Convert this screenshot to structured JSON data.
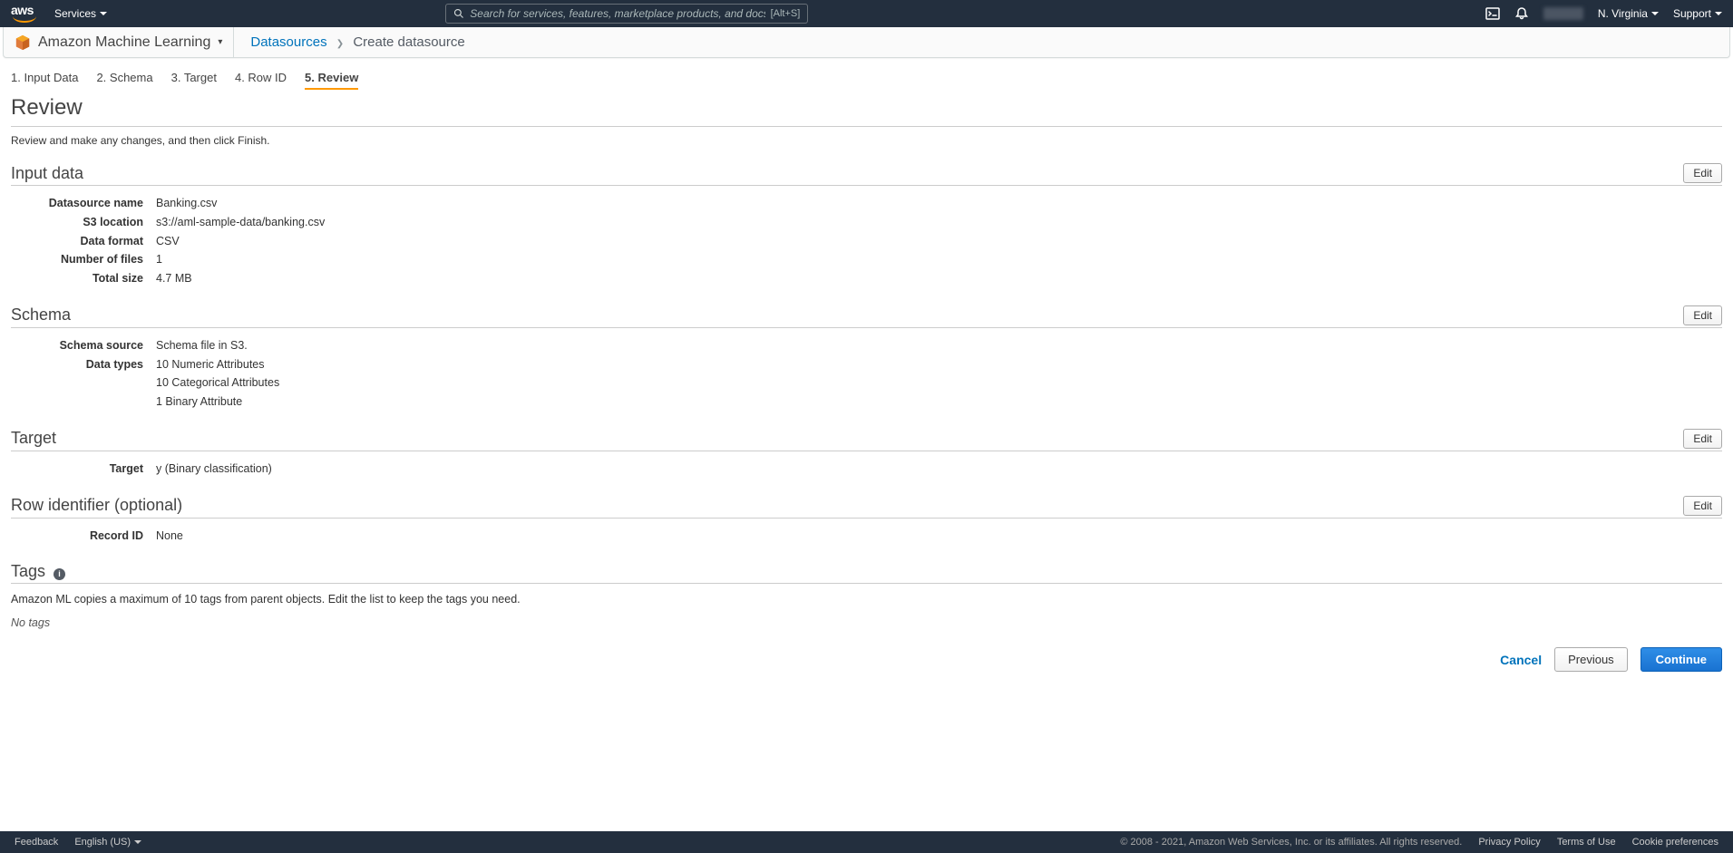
{
  "nav": {
    "logo_text": "aws",
    "services": "Services",
    "search_placeholder": "Search for services, features, marketplace products, and docs",
    "search_kbd": "[Alt+S]",
    "region": "N. Virginia",
    "support": "Support"
  },
  "service_bar": {
    "service_name": "Amazon Machine Learning",
    "breadcrumb_link": "Datasources",
    "breadcrumb_current": "Create datasource"
  },
  "wizard": {
    "steps": [
      "1. Input Data",
      "2. Schema",
      "3. Target",
      "4. Row ID",
      "5. Review"
    ],
    "active_index": 4
  },
  "page_title": "Review",
  "instruction": "Review and make any changes, and then click Finish.",
  "edit_label": "Edit",
  "sections": {
    "input_data": {
      "title": "Input data",
      "rows": [
        {
          "label": "Datasource name",
          "value": "Banking.csv"
        },
        {
          "label": "S3 location",
          "value": "s3://aml-sample-data/banking.csv"
        },
        {
          "label": "Data format",
          "value": "CSV"
        },
        {
          "label": "Number of files",
          "value": "1"
        },
        {
          "label": "Total size",
          "value": "4.7 MB"
        }
      ]
    },
    "schema": {
      "title": "Schema",
      "rows": [
        {
          "label": "Schema source",
          "value": "Schema file in S3."
        },
        {
          "label": "Data types",
          "value": "10 Numeric Attributes"
        },
        {
          "label": "",
          "value": "10 Categorical Attributes"
        },
        {
          "label": "",
          "value": "1 Binary Attribute"
        }
      ]
    },
    "target": {
      "title": "Target",
      "rows": [
        {
          "label": "Target",
          "value": "y (Binary classification)"
        }
      ]
    },
    "row_id": {
      "title": "Row identifier (optional)",
      "rows": [
        {
          "label": "Record ID",
          "value": "None"
        }
      ]
    },
    "tags": {
      "title": "Tags",
      "subtext": "Amazon ML copies a maximum of 10 tags from parent objects. Edit the list to keep the tags you need.",
      "no_tags": "No tags"
    }
  },
  "actions": {
    "cancel": "Cancel",
    "previous": "Previous",
    "continue": "Continue"
  },
  "footer": {
    "feedback": "Feedback",
    "language": "English (US)",
    "copyright": "© 2008 - 2021, Amazon Web Services, Inc. or its affiliates. All rights reserved.",
    "privacy": "Privacy Policy",
    "terms": "Terms of Use",
    "cookie": "Cookie preferences"
  }
}
